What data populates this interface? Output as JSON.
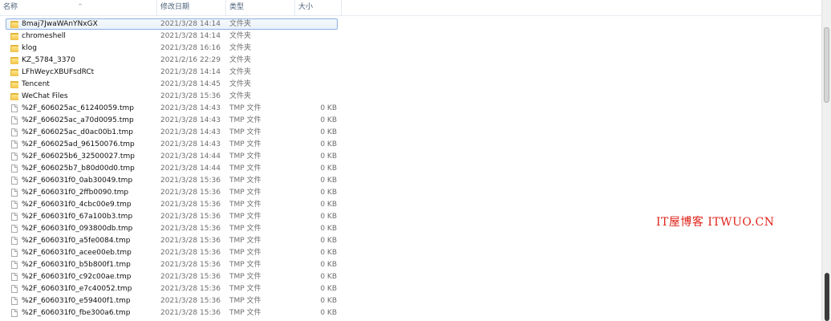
{
  "columns": {
    "name": "名称",
    "date": "修改日期",
    "type": "类型",
    "size": "大小"
  },
  "rows": [
    {
      "name": "8maj7JwaWAnYNxGX",
      "date": "2021/3/28 14:14",
      "type": "文件夹",
      "size": "",
      "kind": "folder"
    },
    {
      "name": "chromeshell",
      "date": "2021/3/28 14:14",
      "type": "文件夹",
      "size": "",
      "kind": "folder"
    },
    {
      "name": "klog",
      "date": "2021/3/28 16:16",
      "type": "文件夹",
      "size": "",
      "kind": "folder"
    },
    {
      "name": "KZ_5784_3370",
      "date": "2021/2/16 22:29",
      "type": "文件夹",
      "size": "",
      "kind": "folder"
    },
    {
      "name": "LFhWeycXBUFsdRCt",
      "date": "2021/3/28 14:14",
      "type": "文件夹",
      "size": "",
      "kind": "folder"
    },
    {
      "name": "Tencent",
      "date": "2021/3/28 14:45",
      "type": "文件夹",
      "size": "",
      "kind": "folder"
    },
    {
      "name": "WeChat Files",
      "date": "2021/3/28 15:36",
      "type": "文件夹",
      "size": "",
      "kind": "folder"
    },
    {
      "name": "%2F_606025ac_61240059.tmp",
      "date": "2021/3/28 14:43",
      "type": "TMP 文件",
      "size": "0 KB",
      "kind": "file"
    },
    {
      "name": "%2F_606025ac_a70d0095.tmp",
      "date": "2021/3/28 14:43",
      "type": "TMP 文件",
      "size": "0 KB",
      "kind": "file"
    },
    {
      "name": "%2F_606025ac_d0ac00b1.tmp",
      "date": "2021/3/28 14:43",
      "type": "TMP 文件",
      "size": "0 KB",
      "kind": "file"
    },
    {
      "name": "%2F_606025ad_96150076.tmp",
      "date": "2021/3/28 14:43",
      "type": "TMP 文件",
      "size": "0 KB",
      "kind": "file"
    },
    {
      "name": "%2F_606025b6_32500027.tmp",
      "date": "2021/3/28 14:44",
      "type": "TMP 文件",
      "size": "0 KB",
      "kind": "file"
    },
    {
      "name": "%2F_606025b7_b80d00d0.tmp",
      "date": "2021/3/28 14:44",
      "type": "TMP 文件",
      "size": "0 KB",
      "kind": "file"
    },
    {
      "name": "%2F_606031f0_0ab30049.tmp",
      "date": "2021/3/28 15:36",
      "type": "TMP 文件",
      "size": "0 KB",
      "kind": "file"
    },
    {
      "name": "%2F_606031f0_2ffb0090.tmp",
      "date": "2021/3/28 15:36",
      "type": "TMP 文件",
      "size": "0 KB",
      "kind": "file"
    },
    {
      "name": "%2F_606031f0_4cbc00e9.tmp",
      "date": "2021/3/28 15:36",
      "type": "TMP 文件",
      "size": "0 KB",
      "kind": "file"
    },
    {
      "name": "%2F_606031f0_67a100b3.tmp",
      "date": "2021/3/28 15:36",
      "type": "TMP 文件",
      "size": "0 KB",
      "kind": "file"
    },
    {
      "name": "%2F_606031f0_093800db.tmp",
      "date": "2021/3/28 15:36",
      "type": "TMP 文件",
      "size": "0 KB",
      "kind": "file"
    },
    {
      "name": "%2F_606031f0_a5fe0084.tmp",
      "date": "2021/3/28 15:36",
      "type": "TMP 文件",
      "size": "0 KB",
      "kind": "file"
    },
    {
      "name": "%2F_606031f0_acee00eb.tmp",
      "date": "2021/3/28 15:36",
      "type": "TMP 文件",
      "size": "0 KB",
      "kind": "file"
    },
    {
      "name": "%2F_606031f0_b5b800f1.tmp",
      "date": "2021/3/28 15:36",
      "type": "TMP 文件",
      "size": "0 KB",
      "kind": "file"
    },
    {
      "name": "%2F_606031f0_c92c00ae.tmp",
      "date": "2021/3/28 15:36",
      "type": "TMP 文件",
      "size": "0 KB",
      "kind": "file"
    },
    {
      "name": "%2F_606031f0_e7c40052.tmp",
      "date": "2021/3/28 15:36",
      "type": "TMP 文件",
      "size": "0 KB",
      "kind": "file"
    },
    {
      "name": "%2F_606031f0_e59400f1.tmp",
      "date": "2021/3/28 15:36",
      "type": "TMP 文件",
      "size": "0 KB",
      "kind": "file"
    },
    {
      "name": "%2F_606031f0_fbe300a6.tmp",
      "date": "2021/3/28 15:36",
      "type": "TMP 文件",
      "size": "0 KB",
      "kind": "file"
    }
  ],
  "selected_index": 0,
  "watermark": "IT屋博客 ITWUO.CN",
  "icons": {
    "folder": "folder-icon",
    "file": "file-icon",
    "sort": "sort-up-icon"
  },
  "colors": {
    "selection_border": "#8cb0e0",
    "watermark": "#e0241b",
    "folder": "#f1c24a"
  }
}
